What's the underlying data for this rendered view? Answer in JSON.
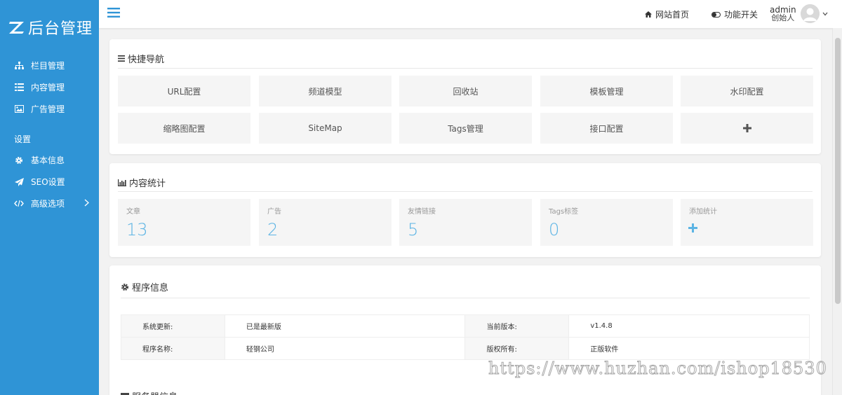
{
  "sidebar": {
    "logo_text": "后台管理",
    "items": [
      {
        "label": "栏目管理",
        "icon": "sitemap-icon"
      },
      {
        "label": "内容管理",
        "icon": "list-icon"
      },
      {
        "label": "广告管理",
        "icon": "image-icon"
      }
    ],
    "group_label": "设置",
    "settings_items": [
      {
        "label": "基本信息",
        "icon": "gear-icon"
      },
      {
        "label": "SEO设置",
        "icon": "paper-plane-icon"
      },
      {
        "label": "高级选项",
        "icon": "code-icon"
      }
    ]
  },
  "header": {
    "home_link": "网站首页",
    "feature_toggle": "功能开关",
    "user_name": "admin",
    "user_role": "创始人"
  },
  "quick_nav": {
    "title": "快捷导航",
    "buttons": [
      "URL配置",
      "频道模型",
      "回收站",
      "模板管理",
      "水印配置",
      "缩略图配置",
      "SiteMap",
      "Tags管理",
      "接口配置"
    ]
  },
  "stats": {
    "title": "内容统计",
    "cards": [
      {
        "label": "文章",
        "value": "13"
      },
      {
        "label": "广告",
        "value": "2"
      },
      {
        "label": "友情链接",
        "value": "5"
      },
      {
        "label": "Tags标签",
        "value": "0"
      }
    ],
    "add_label": "添加统计"
  },
  "program_info": {
    "title": "程序信息",
    "rows": [
      {
        "k1": "系统更新:",
        "v1": "已是最新版",
        "k2": "当前版本:",
        "v2": "v1.4.8"
      },
      {
        "k1": "程序名称:",
        "v1": "轻钢公司",
        "k2": "版权所有:",
        "v2": "正版软件"
      }
    ]
  },
  "next_section_title": "服务器信息",
  "watermark": "https://www.huzhan.com/ishop18530",
  "colors": {
    "sidebar": "#2f94d6",
    "accent": "#5cb4e4"
  }
}
